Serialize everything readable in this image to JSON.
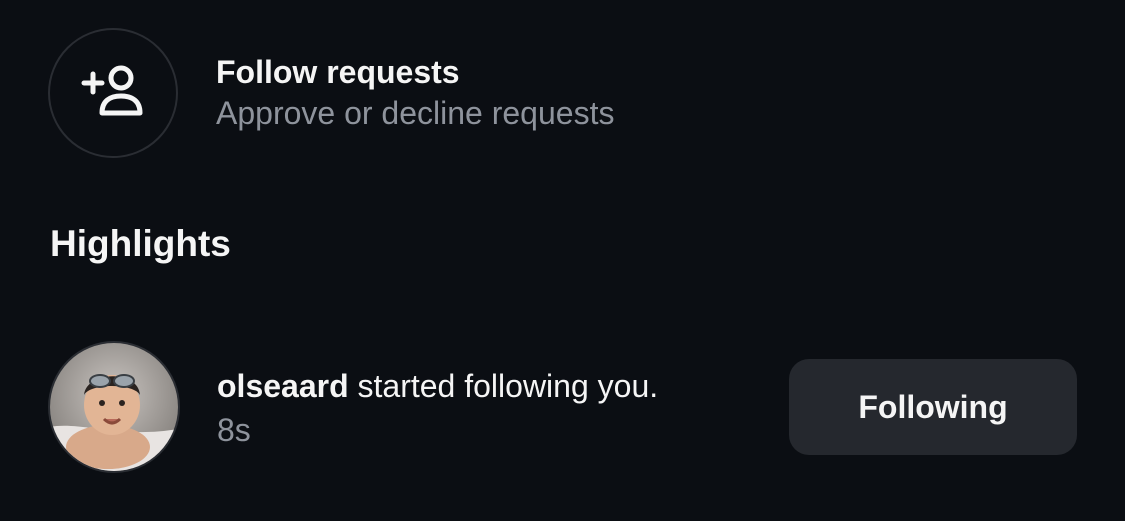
{
  "follow_requests": {
    "icon": "add-person-icon",
    "title": "Follow requests",
    "subtitle": "Approve or decline requests"
  },
  "highlights": {
    "heading": "Highlights",
    "items": [
      {
        "avatar_icon": "user-avatar",
        "username": "olseaard",
        "action": " started following you.",
        "time": "8s",
        "button_label": "Following"
      }
    ]
  },
  "colors": {
    "background": "#0b0e13",
    "text_primary": "#f5f5f5",
    "text_secondary": "#8e939c",
    "button_bg": "#25282e",
    "circle_border": "#2a2d33"
  }
}
